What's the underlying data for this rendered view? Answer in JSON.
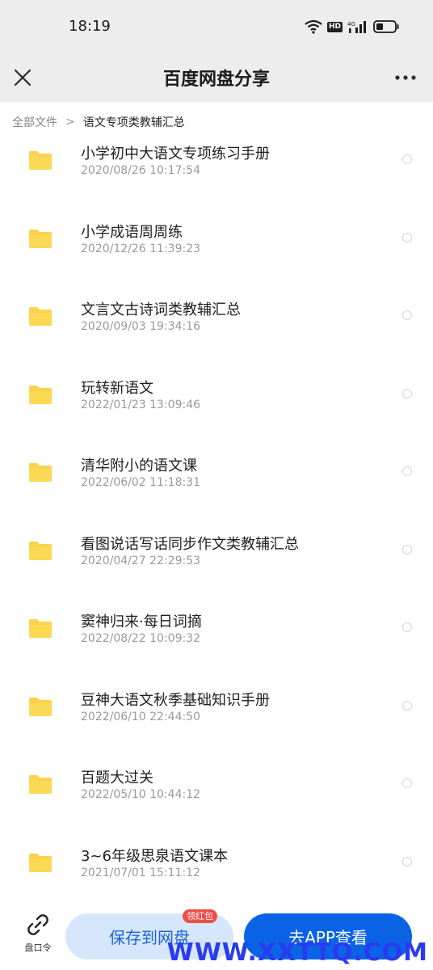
{
  "status_bar": {
    "time": "18:19",
    "hd_badge": "HD",
    "network": "4G"
  },
  "header": {
    "title": "百度网盘分享"
  },
  "breadcrumb": {
    "root": "全部文件",
    "separator": ">",
    "current": "语文专项类教辅汇总"
  },
  "files": [
    {
      "name": "小学初中大语文专项练习手册",
      "date": "2020/08/26 10:17:54"
    },
    {
      "name": "小学成语周周练",
      "date": "2020/12/26 11:39:23"
    },
    {
      "name": "文言文古诗词类教辅汇总",
      "date": "2020/09/03 19:34:16"
    },
    {
      "name": "玩转新语文",
      "date": "2022/01/23 13:09:46"
    },
    {
      "name": "清华附小的语文课",
      "date": "2022/06/02 11:18:31"
    },
    {
      "name": "看图说话写话同步作文类教辅汇总",
      "date": "2020/04/27 22:29:53"
    },
    {
      "name": "窦神归来·每日词摘",
      "date": "2022/08/22 10:09:32"
    },
    {
      "name": "豆神大语文秋季基础知识手册",
      "date": "2022/06/10 22:44:50"
    },
    {
      "name": "百题大过关",
      "date": "2022/05/10 10:44:12"
    },
    {
      "name": "3~6年级思泉语文课本",
      "date": "2021/07/01 15:11:12"
    }
  ],
  "bottom": {
    "share_link_label": "盘口令",
    "save_label": "保存到网盘",
    "badge_label": "领红包",
    "open_app_label": "去APP查看"
  },
  "watermark": "WWW.XXTTQ.COM",
  "colors": {
    "folder": "#fbd34b",
    "primary_blue": "#0b63e6",
    "light_blue": "#d6e6fb",
    "badge_red": "#f04c43",
    "header_bg": "#ededed"
  }
}
